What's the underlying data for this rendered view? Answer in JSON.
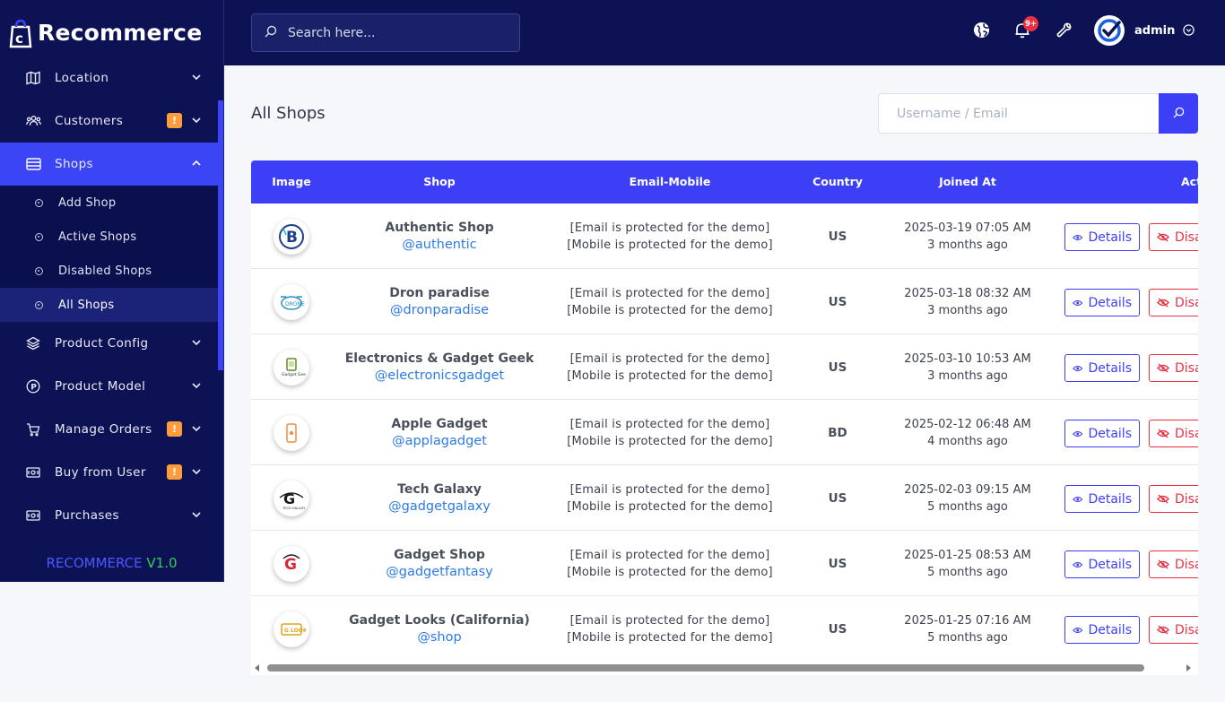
{
  "brand": {
    "name": "Recommerce"
  },
  "sidebar": {
    "items": [
      {
        "label": "Location",
        "icon": "map-icon",
        "badge": null
      },
      {
        "label": "Customers",
        "icon": "users-icon",
        "badge": "!"
      },
      {
        "label": "Shops",
        "icon": "store-icon",
        "badge": null,
        "open": true,
        "children": [
          {
            "label": "Add Shop"
          },
          {
            "label": "Active Shops"
          },
          {
            "label": "Disabled Shops"
          },
          {
            "label": "All Shops",
            "active": true
          }
        ]
      },
      {
        "label": "Product Config",
        "icon": "layers-icon",
        "badge": null
      },
      {
        "label": "Product Model",
        "icon": "product-p-icon",
        "badge": null
      },
      {
        "label": "Manage Orders",
        "icon": "cart-icon",
        "badge": "!"
      },
      {
        "label": "Buy from User",
        "icon": "cash-icon",
        "badge": "!"
      },
      {
        "label": "Purchases",
        "icon": "cash-icon",
        "badge": null
      }
    ],
    "version_name": "RECOMMERCE",
    "version_number": "V1.0"
  },
  "topbar": {
    "search_placeholder": "Search here...",
    "notification_count": "9+",
    "user_name": "admin"
  },
  "main": {
    "title": "All Shops",
    "filter_placeholder": "Username / Email",
    "columns": [
      "Image",
      "Shop",
      "Email-Mobile",
      "Country",
      "Joined At",
      "Actions"
    ],
    "actions": {
      "details": "Details",
      "disable": "Disable"
    },
    "rows": [
      {
        "name": "Authentic Shop",
        "handle": "@authentic",
        "email": "[Email is protected for the demo]",
        "mobile": "[Mobile is protected for the demo]",
        "country": "US",
        "joined": "2025-03-19 07:05 AM",
        "ago": "3 months ago",
        "logo": "cart-b-logo"
      },
      {
        "name": "Dron paradise",
        "handle": "@dronparadise",
        "email": "[Email is protected for the demo]",
        "mobile": "[Mobile is protected for the demo]",
        "country": "US",
        "joined": "2025-03-18 08:32 AM",
        "ago": "3 months ago",
        "logo": "drone-logo"
      },
      {
        "name": "Electronics & Gadget Geek",
        "handle": "@electronicsgadget",
        "email": "[Email is protected for the demo]",
        "mobile": "[Mobile is protected for the demo]",
        "country": "US",
        "joined": "2025-03-10 10:53 AM",
        "ago": "3 months ago",
        "logo": "geek-logo"
      },
      {
        "name": "Apple Gadget",
        "handle": "@applagadget",
        "email": "[Email is protected for the demo]",
        "mobile": "[Mobile is protected for the demo]",
        "country": "BD",
        "joined": "2025-02-12 06:48 AM",
        "ago": "4 months ago",
        "logo": "phone-logo"
      },
      {
        "name": "Tech Galaxy",
        "handle": "@gadgetgalaxy",
        "email": "[Email is protected for the demo]",
        "mobile": "[Mobile is protected for the demo]",
        "country": "US",
        "joined": "2025-02-03 09:15 AM",
        "ago": "5 months ago",
        "logo": "galaxy-logo"
      },
      {
        "name": "Gadget Shop",
        "handle": "@gadgetfantasy",
        "email": "[Email is protected for the demo]",
        "mobile": "[Mobile is protected for the demo]",
        "country": "US",
        "joined": "2025-01-25 08:53 AM",
        "ago": "5 months ago",
        "logo": "g-logo"
      },
      {
        "name": "Gadget Looks (California)",
        "handle": "@shop",
        "email": "[Email is protected for the demo]",
        "mobile": "[Mobile is protected for the demo]",
        "country": "US",
        "joined": "2025-01-25 07:16 AM",
        "ago": "5 months ago",
        "logo": "looks-logo"
      }
    ]
  },
  "colors": {
    "navy": "#0c1254",
    "accent": "#3c3ff5",
    "danger": "#e93143",
    "warning": "#ff9d3c",
    "link": "#2c7be5"
  }
}
